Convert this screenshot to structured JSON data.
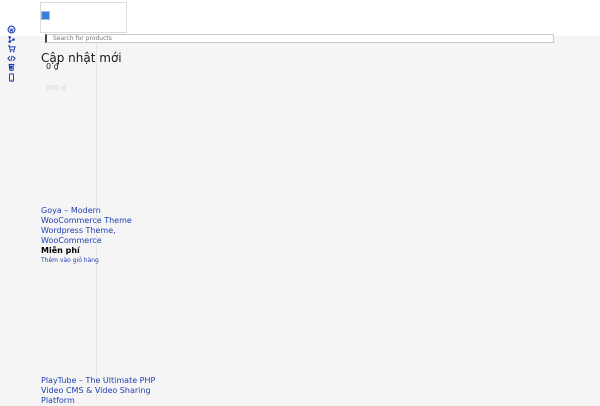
{
  "header": {
    "logo_icon": "broken-image-icon",
    "search_placeholder": "Search for products"
  },
  "sidebar": {
    "icons": [
      "wordpress-icon",
      "share-icon",
      "cart-icon",
      "code-icon",
      "css3-icon",
      "mobile-icon"
    ],
    "color": "#1f3fb0"
  },
  "section": {
    "title": "Cập nhật mới",
    "cart_count": "0 ₫",
    "faint_text": "000 ₫"
  },
  "products": [
    {
      "title": "Goya – Modern WooCommerce Theme",
      "categories": "Wordpress Theme, WooCommerce",
      "price": "Miễn phí",
      "cart_label": "Thêm vào giỏ hàng"
    },
    {
      "title": "PlayTube – The Ultimate PHP Video CMS & Video Sharing Platform"
    }
  ]
}
